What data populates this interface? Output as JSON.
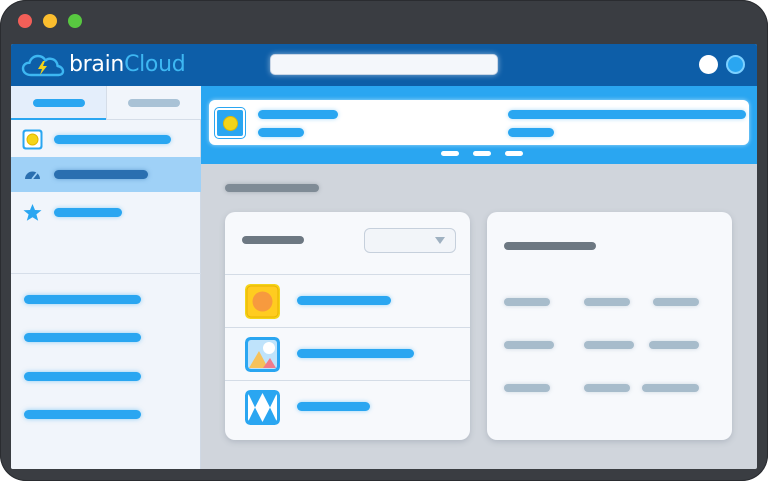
{
  "window": {
    "controls": [
      "close-icon",
      "minimize-icon",
      "zoom-icon"
    ],
    "frame_color": "#3a3d42"
  },
  "header": {
    "brand_prefix": "brain",
    "brand_suffix": "Cloud",
    "logo_icon": "cloud-lightning-icon",
    "background": "#0d5ea8",
    "actions": [
      "notifications-dot",
      "profile-avatar"
    ]
  },
  "sidebar": {
    "tabs": [
      {
        "state": "active"
      },
      {
        "state": "inactive"
      }
    ],
    "items": [
      {
        "icon": "app-thumbnail-icon",
        "selected": false
      },
      {
        "icon": "dashboard-gauge-icon",
        "selected": true
      },
      {
        "icon": "star-icon",
        "selected": false
      }
    ],
    "links_count_visible": 4
  },
  "main": {
    "banner": {
      "icon": "app-thumbnail-icon",
      "pager_pages": 3,
      "accent": "#2aa6f1"
    },
    "left_card": {
      "rows": [
        {
          "icon": "sun-tile-icon"
        },
        {
          "icon": "image-landscape-icon"
        },
        {
          "icon": "diamond-pattern-icon"
        }
      ]
    },
    "right_card": {
      "grid_rows": 3,
      "grid_cols": 3
    }
  },
  "colors": {
    "accent": "#2aa6f1",
    "header": "#0d5ea8",
    "selected": "#9fd1f7",
    "placeholder_dark": "#6d7882",
    "placeholder_light": "#a7bccb"
  }
}
